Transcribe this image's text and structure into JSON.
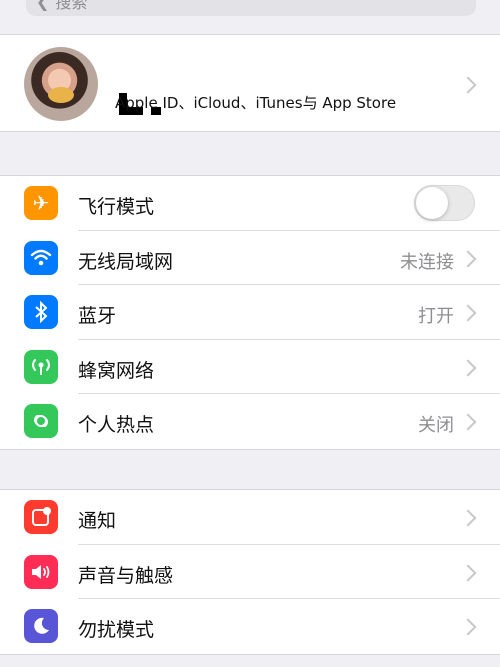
{
  "search": {
    "label": "搜索"
  },
  "profile": {
    "subtitle": "Apple ID、iCloud、iTunes与 App Store"
  },
  "network_group": [
    {
      "label": "飞行模式",
      "icon": "airplane-icon",
      "color": "#ff9500",
      "toggle": "off"
    },
    {
      "label": "无线局域网",
      "value": "未连接",
      "icon": "wifi-icon",
      "color": "#007aff"
    },
    {
      "label": "蓝牙",
      "value": "打开",
      "icon": "bluetooth-icon",
      "color": "#007aff"
    },
    {
      "label": "蜂窝网络",
      "icon": "cellular-icon",
      "color": "#34c759"
    },
    {
      "label": "个人热点",
      "value": "关闭",
      "icon": "hotspot-icon",
      "color": "#34c759"
    }
  ],
  "notify_group": [
    {
      "label": "通知",
      "icon": "notification-icon",
      "color": "#ff3b30"
    },
    {
      "label": "声音与触感",
      "icon": "sound-icon",
      "color": "#ff2d55"
    },
    {
      "label": "勿扰模式",
      "icon": "moon-icon",
      "color": "#5856d6"
    }
  ]
}
